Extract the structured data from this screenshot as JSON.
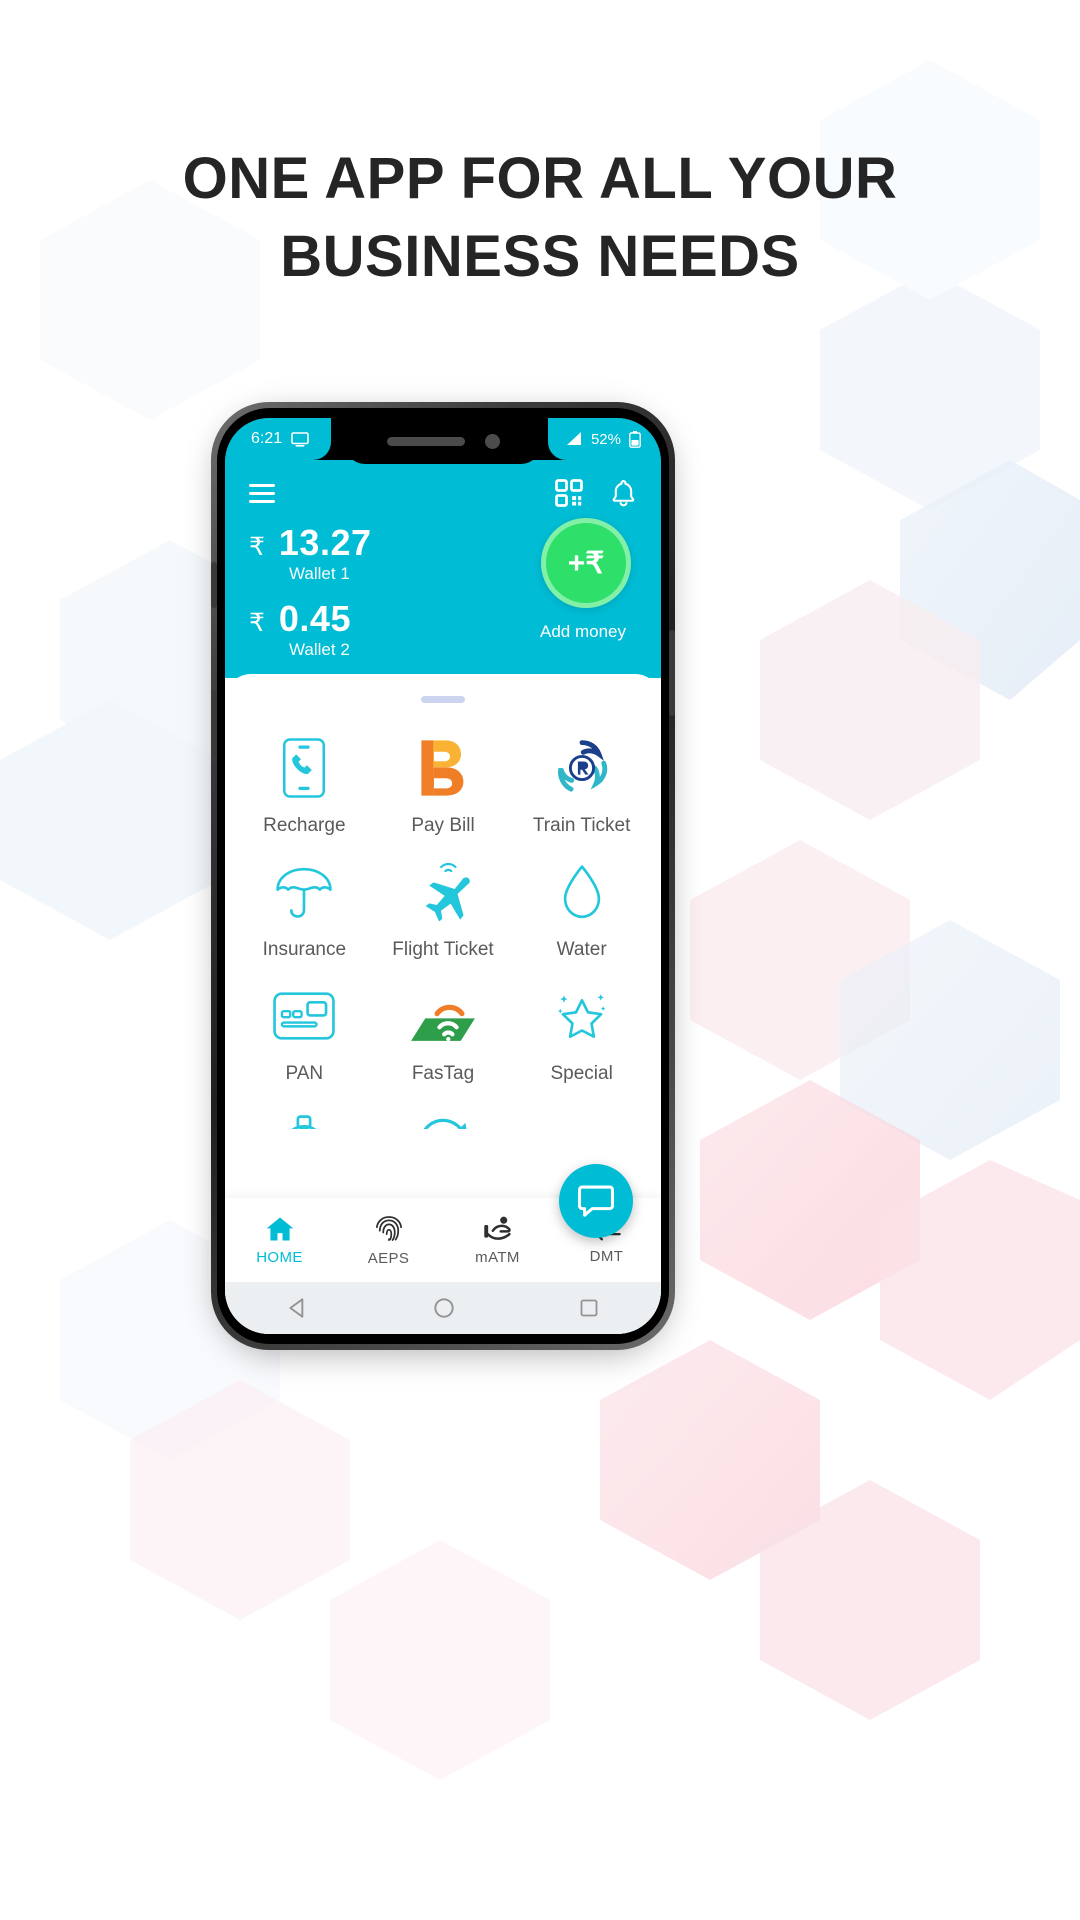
{
  "headline": {
    "line1": "ONE APP FOR ALL YOUR",
    "line2": "BUSINESS NEEDS"
  },
  "colors": {
    "accent": "#00bcd4",
    "green": "#2ee06a",
    "green_ring": "#83f0a7",
    "headline": "#252525",
    "label": "#5a5a5a",
    "grabber": "#ccd4f0",
    "android_nav_bg": "#eceff1",
    "orange": "#f07e26",
    "yellow": "#f9b233"
  },
  "status_bar": {
    "time": "6:21",
    "cast_icon": "monitor-icon",
    "signal_icon": "signal-icon",
    "battery_percent": "52%",
    "battery_icon": "battery-icon"
  },
  "header": {
    "menu_icon": "hamburger-menu-icon",
    "qr_icon": "qr-scan-icon",
    "bell_icon": "notification-bell-icon",
    "wallets": [
      {
        "currency": "₹",
        "amount": "13.27",
        "label": "Wallet 1"
      },
      {
        "currency": "₹",
        "amount": "0.45",
        "label": "Wallet 2"
      }
    ],
    "add_money": {
      "symbol": "+₹",
      "label": "Add money",
      "icon": "add-money-icon"
    }
  },
  "services": [
    {
      "label": "Recharge",
      "icon": "mobile-recharge-icon"
    },
    {
      "label": "Pay Bill",
      "icon": "paybill-b-logo-icon"
    },
    {
      "label": "Train Ticket",
      "icon": "irctc-train-icon"
    },
    {
      "label": "Insurance",
      "icon": "umbrella-icon"
    },
    {
      "label": "Flight Ticket",
      "icon": "airplane-icon"
    },
    {
      "label": "Water",
      "icon": "water-drop-icon"
    },
    {
      "label": "PAN",
      "icon": "pan-card-icon"
    },
    {
      "label": "FasTag",
      "icon": "fastag-icon"
    },
    {
      "label": "Special",
      "icon": "special-star-icon"
    }
  ],
  "services_partial_row": [
    {
      "icon": "gas-cylinder-icon"
    },
    {
      "icon": "refresh-arrow-icon"
    }
  ],
  "fab": {
    "icon": "chat-bubble-icon"
  },
  "bottom_tabs": [
    {
      "label": "HOME",
      "icon": "home-icon",
      "active": true
    },
    {
      "label": "AEPS",
      "icon": "fingerprint-icon",
      "active": false
    },
    {
      "label": "mATM",
      "icon": "matm-hand-icon",
      "active": false
    },
    {
      "label": "DMT",
      "icon": "transfer-arrows-icon",
      "active": false
    }
  ],
  "android_nav": [
    {
      "icon": "back-triangle-icon"
    },
    {
      "icon": "home-circle-icon"
    },
    {
      "icon": "recents-square-icon"
    }
  ]
}
